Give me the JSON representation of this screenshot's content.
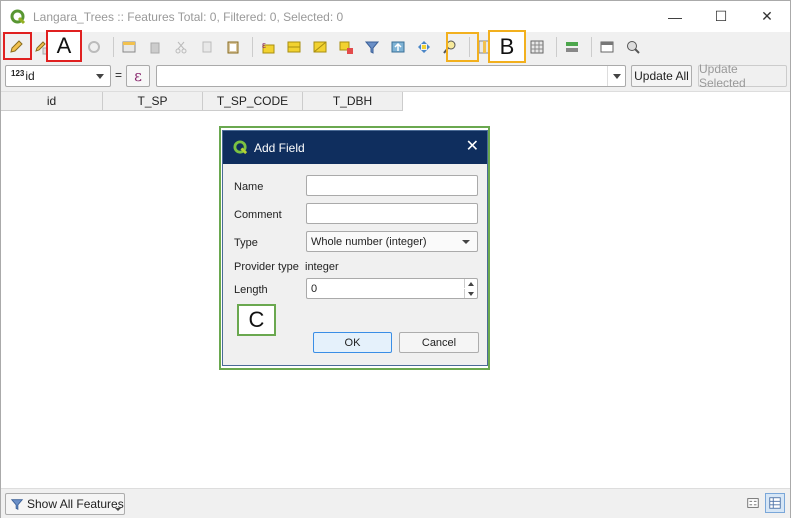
{
  "window": {
    "title": "Langara_Trees :: Features Total: 0, Filtered: 0, Selected: 0",
    "minimize": "—",
    "maximize": "☐",
    "close": "✕"
  },
  "toolbar": {
    "icons": [
      "pencil-icon",
      "multi-edit-icon",
      "save-edits-icon",
      "reload-icon",
      "add-feature-icon",
      "delete-feature-icon",
      "cut-icon",
      "copy-icon",
      "paste-icon",
      "expression-select-icon",
      "select-all-icon",
      "invert-selection-icon",
      "deselect-icon",
      "filter-icon",
      "move-to-top-icon",
      "pan-to-selection-icon",
      "zoom-to-selection-icon",
      "new-field-icon",
      "delete-field-icon",
      "field-calculator-icon",
      "conditional-format-icon",
      "dock-icon",
      "actions-icon"
    ]
  },
  "exprbar": {
    "field_prefix": "123",
    "field": "id",
    "equals": "=",
    "epsilon": "ε",
    "expression_value": "",
    "update_all": "Update All",
    "update_selected": "Update Selected"
  },
  "table": {
    "columns": [
      "id",
      "T_SP",
      "T_SP_CODE",
      "T_DBH"
    ]
  },
  "statusbar": {
    "show_all": "Show All Features"
  },
  "annotations": {
    "a": "A",
    "b": "B",
    "c": "C",
    "colors": {
      "a": "#e02020",
      "b": "#f2b01e",
      "c": "#6aa84f"
    }
  },
  "dialog": {
    "title": "Add Field",
    "name_label": "Name",
    "name_value": "",
    "comment_label": "Comment",
    "comment_value": "",
    "type_label": "Type",
    "type_value": "Whole number (integer)",
    "provider_type_label": "Provider type",
    "provider_type_value": "integer",
    "length_label": "Length",
    "length_value": "0",
    "ok": "OK",
    "cancel": "Cancel"
  }
}
